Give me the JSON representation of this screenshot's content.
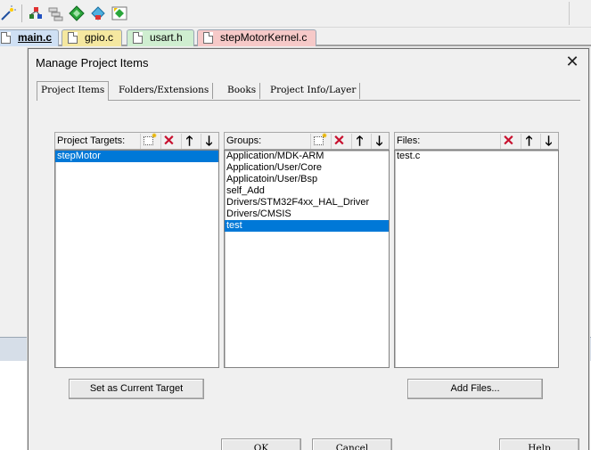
{
  "toolbar": {
    "icons": [
      "wand-icon",
      "load-icon",
      "translate-icon",
      "rebuild-icon",
      "stop-build-icon",
      "manage-components-icon"
    ]
  },
  "file_tabs": [
    {
      "label": "main.c",
      "active": true,
      "color": "#cfe0f4"
    },
    {
      "label": "gpio.c",
      "active": false,
      "color": "#f5e8a0"
    },
    {
      "label": "usart.h",
      "active": false,
      "color": "#cfeed0"
    },
    {
      "label": "stepMotorKernel.c",
      "active": false,
      "color": "#f6c9c8"
    }
  ],
  "dialog": {
    "title": "Manage Project Items",
    "close_symbol": "✕",
    "tabs": [
      {
        "label": "Project Items",
        "active": true
      },
      {
        "label": "Folders/Extensions",
        "active": false
      },
      {
        "label": "Books",
        "active": false
      },
      {
        "label": "Project Info/Layer",
        "active": false
      }
    ],
    "targets": {
      "label": "Project Targets:",
      "items": [
        "stepMotor"
      ],
      "selected": 0
    },
    "groups": {
      "label": "Groups:",
      "items": [
        "Application/MDK-ARM",
        "Application/User/Core",
        "Applicatoin/User/Bsp",
        "self_Add",
        "Drivers/STM32F4xx_HAL_Driver",
        "Drivers/CMSIS",
        "test"
      ],
      "selected": 6
    },
    "files": {
      "label": "Files:",
      "items": [
        "test.c"
      ],
      "selected": -1
    },
    "set_current_target_label": "Set as Current Target",
    "add_files_label": "Add Files...",
    "ok_label": "OK",
    "cancel_label": "Cancel",
    "help_label": "Help"
  },
  "colors": {
    "selection": "#0078d7",
    "delete_icon": "#c8102e"
  }
}
